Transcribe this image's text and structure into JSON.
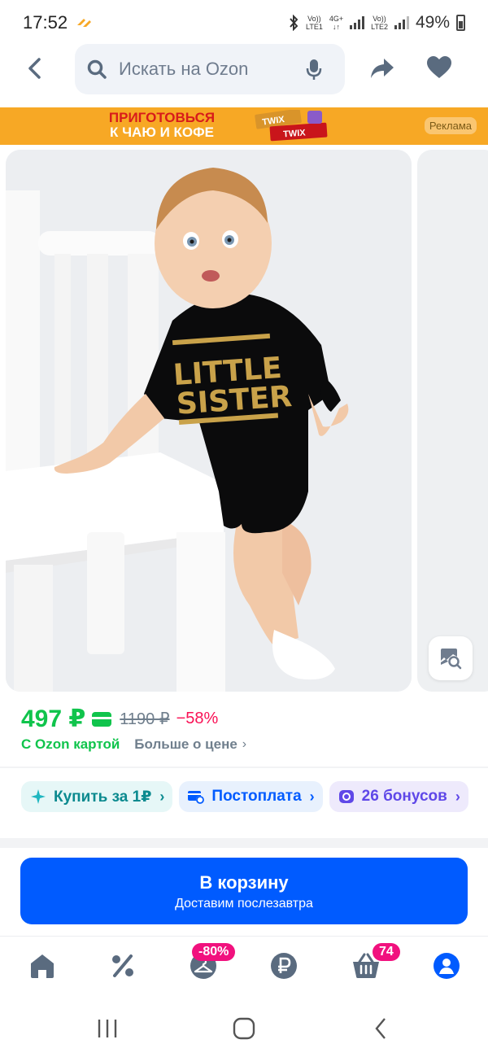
{
  "status_bar": {
    "time": "17:52",
    "sim1_label": "Vo)) LTE1",
    "net": "4G+",
    "sim2_label": "Vo)) LTE2",
    "battery_pct": "49%"
  },
  "header": {
    "search_placeholder": "Искать на Ozon",
    "icons": [
      "back-arrow-icon",
      "search-icon",
      "mic-icon",
      "share-icon",
      "heart-icon"
    ]
  },
  "banner": {
    "line1": "ПРИГОТОВЬСЯ",
    "line2": "К ЧАЮ И КОФЕ",
    "brand": "TWIX",
    "ad_label": "Реклама"
  },
  "product_photo": {
    "shirt_text_1": "LITTLE",
    "shirt_text_2": "SISTER"
  },
  "price": {
    "current": "497 ₽",
    "old": "1190 ₽",
    "discount": "−58%",
    "ozon_card": "С Ozon картой",
    "more": "Больше о цене"
  },
  "chips": [
    {
      "label": "Купить за 1₽",
      "icon": "sparkle-icon"
    },
    {
      "label": "Постоплата",
      "icon": "card-clock-icon"
    },
    {
      "label": "26 бонусов",
      "icon": "bonus-icon"
    }
  ],
  "cart": {
    "title": "В корзину",
    "subtitle": "Доставим послезавтра"
  },
  "bottom_nav": {
    "sale_badge": "-80%",
    "cart_badge": "74"
  },
  "colors": {
    "brand_blue": "#005bff",
    "price_green": "#10c44c",
    "discount_pink": "#f91155",
    "badge_pink": "#f1117e"
  }
}
